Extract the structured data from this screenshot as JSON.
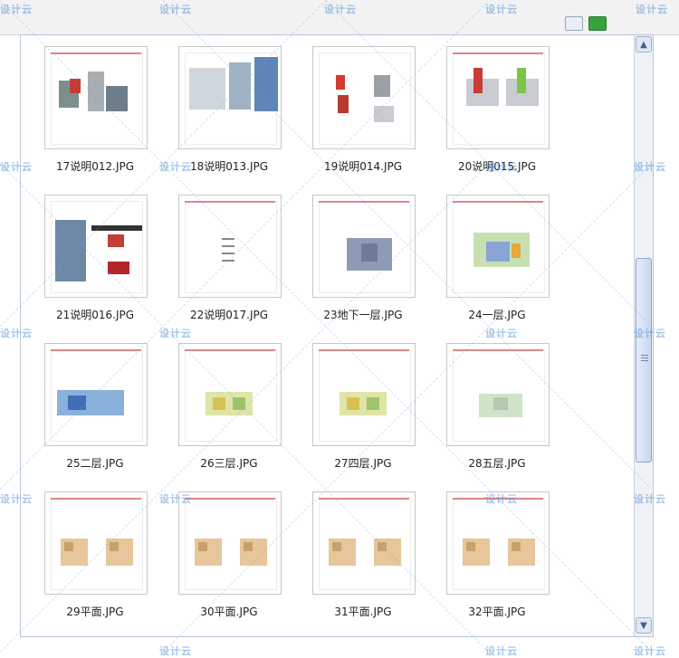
{
  "watermark": "设计云",
  "files": [
    {
      "name": "17说明012.JPG",
      "kind": "photo-red"
    },
    {
      "name": "18说明013.JPG",
      "kind": "photo-building"
    },
    {
      "name": "19说明014.JPG",
      "kind": "diagram-red"
    },
    {
      "name": "20说明015.JPG",
      "kind": "diagram-3d"
    },
    {
      "name": "21说明016.JPG",
      "kind": "photo-mixed"
    },
    {
      "name": "22说明017.JPG",
      "kind": "text-page"
    },
    {
      "name": "23地下一层.JPG",
      "kind": "plan-grey"
    },
    {
      "name": "24一层.JPG",
      "kind": "plan-green"
    },
    {
      "name": "25二层.JPG",
      "kind": "plan-blue"
    },
    {
      "name": "26三层.JPG",
      "kind": "plan-yellow"
    },
    {
      "name": "27四层.JPG",
      "kind": "plan-yellow"
    },
    {
      "name": "28五层.JPG",
      "kind": "plan-light"
    },
    {
      "name": "29平面.JPG",
      "kind": "plan-double"
    },
    {
      "name": "30平面.JPG",
      "kind": "plan-double"
    },
    {
      "name": "31平面.JPG",
      "kind": "plan-double"
    },
    {
      "name": "32平面.JPG",
      "kind": "plan-double"
    }
  ],
  "scrollbar": {
    "up_icon": "▲",
    "down_icon": "▼"
  }
}
